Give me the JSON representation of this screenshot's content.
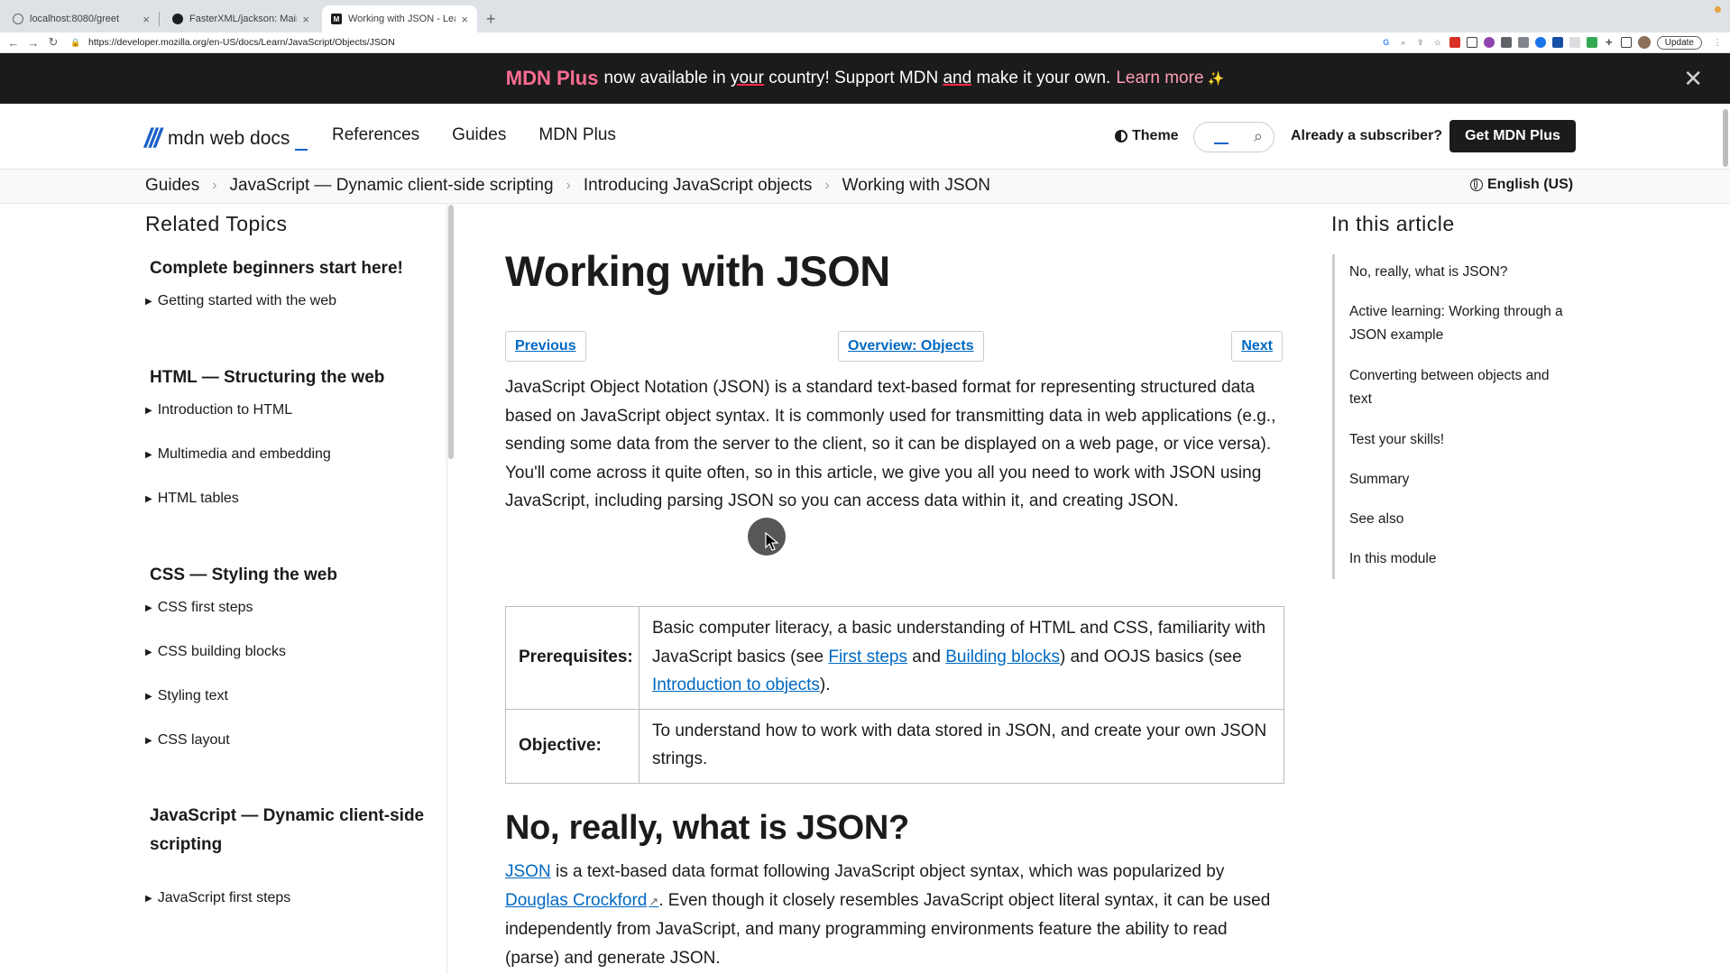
{
  "browser": {
    "tabs": [
      {
        "title": "localhost:8080/greet",
        "active": false
      },
      {
        "title": "FasterXML/jackson: Main Porta",
        "active": false
      },
      {
        "title": "Working with JSON - Learn we",
        "active": true
      }
    ],
    "new_tab_symbol": "+",
    "url": "https://developer.mozilla.org/en-US/docs/Learn/JavaScript/Objects/JSON",
    "update_label": "Update"
  },
  "banner": {
    "brand": "MDN Plus",
    "text_1": "now available in",
    "text_your": "your",
    "text_2": "country! Support MDN",
    "text_and": "and",
    "text_3": "make it your own.",
    "learn_more": "Learn more",
    "sparkle": "✨",
    "close": "✕"
  },
  "header": {
    "logo_text": "mdn web docs",
    "nav": [
      "References",
      "Guides",
      "MDN Plus"
    ],
    "theme_label": "Theme",
    "subscriber_label": "Already a subscriber?",
    "cta_label": "Get MDN Plus"
  },
  "breadcrumbs": {
    "items": [
      "Guides",
      "JavaScript — Dynamic client-side scripting",
      "Introducing JavaScript objects",
      "Working with JSON"
    ],
    "language": "English (US)"
  },
  "sidebar": {
    "title": "Related Topics",
    "sections": [
      {
        "heading": "Complete beginners start here!",
        "items": [
          "Getting started with the web"
        ]
      },
      {
        "heading": "HTML — Structuring the web",
        "items": [
          "Introduction to HTML",
          "Multimedia and embedding",
          "HTML tables"
        ]
      },
      {
        "heading": "CSS — Styling the web",
        "items": [
          "CSS first steps",
          "CSS building blocks",
          "Styling text",
          "CSS layout"
        ]
      },
      {
        "heading": "JavaScript — Dynamic client-side scripting",
        "items": [
          "JavaScript first steps"
        ]
      }
    ]
  },
  "article": {
    "title": "Working with JSON",
    "prev_label": "Previous",
    "overview_label": "Overview: Objects",
    "next_label": "Next",
    "intro": "JavaScript Object Notation (JSON) is a standard text-based format for representing structured data based on JavaScript object syntax. It is commonly used for transmitting data in web applications (e.g., sending some data from the server to the client, so it can be displayed on a web page, or vice versa). You'll come across it quite often, so in this article, we give you all you need to work with JSON using JavaScript, including parsing JSON so you can access data within it, and creating JSON.",
    "prereq_label": "Prerequisites:",
    "prereq_1": "Basic computer literacy, a basic understanding of HTML and CSS, familiarity with JavaScript basics (see",
    "prereq_link_1": "First steps",
    "prereq_2": "and",
    "prereq_link_2": "Building blocks",
    "prereq_3": ") and OOJS basics (see",
    "prereq_link_3": "Introduction to objects",
    "prereq_4": ").",
    "objective_label": "Objective:",
    "objective": "To understand how to work with data stored in JSON, and create your own JSON strings.",
    "h2": "No, really, what is JSON?",
    "p2_link_1": "JSON",
    "p2_1": "is a text-based data format following JavaScript object syntax, which was popularized by",
    "p2_link_2": "Douglas Crockford",
    "p2_2": ". Even though it closely resembles JavaScript object literal syntax, it can be used independently from JavaScript, and many programming environments feature the ability to read (parse) and generate JSON."
  },
  "toc": {
    "title": "In this article",
    "items": [
      "No, really, what is JSON?",
      "Active learning: Working through a JSON example",
      "Converting between objects and text",
      "Test your skills!",
      "Summary",
      "See also",
      "In this module"
    ]
  },
  "colors": {
    "accent": "#0069c2",
    "brand_pink": "#ff6d91",
    "banner_bg": "#1b1b1b"
  }
}
